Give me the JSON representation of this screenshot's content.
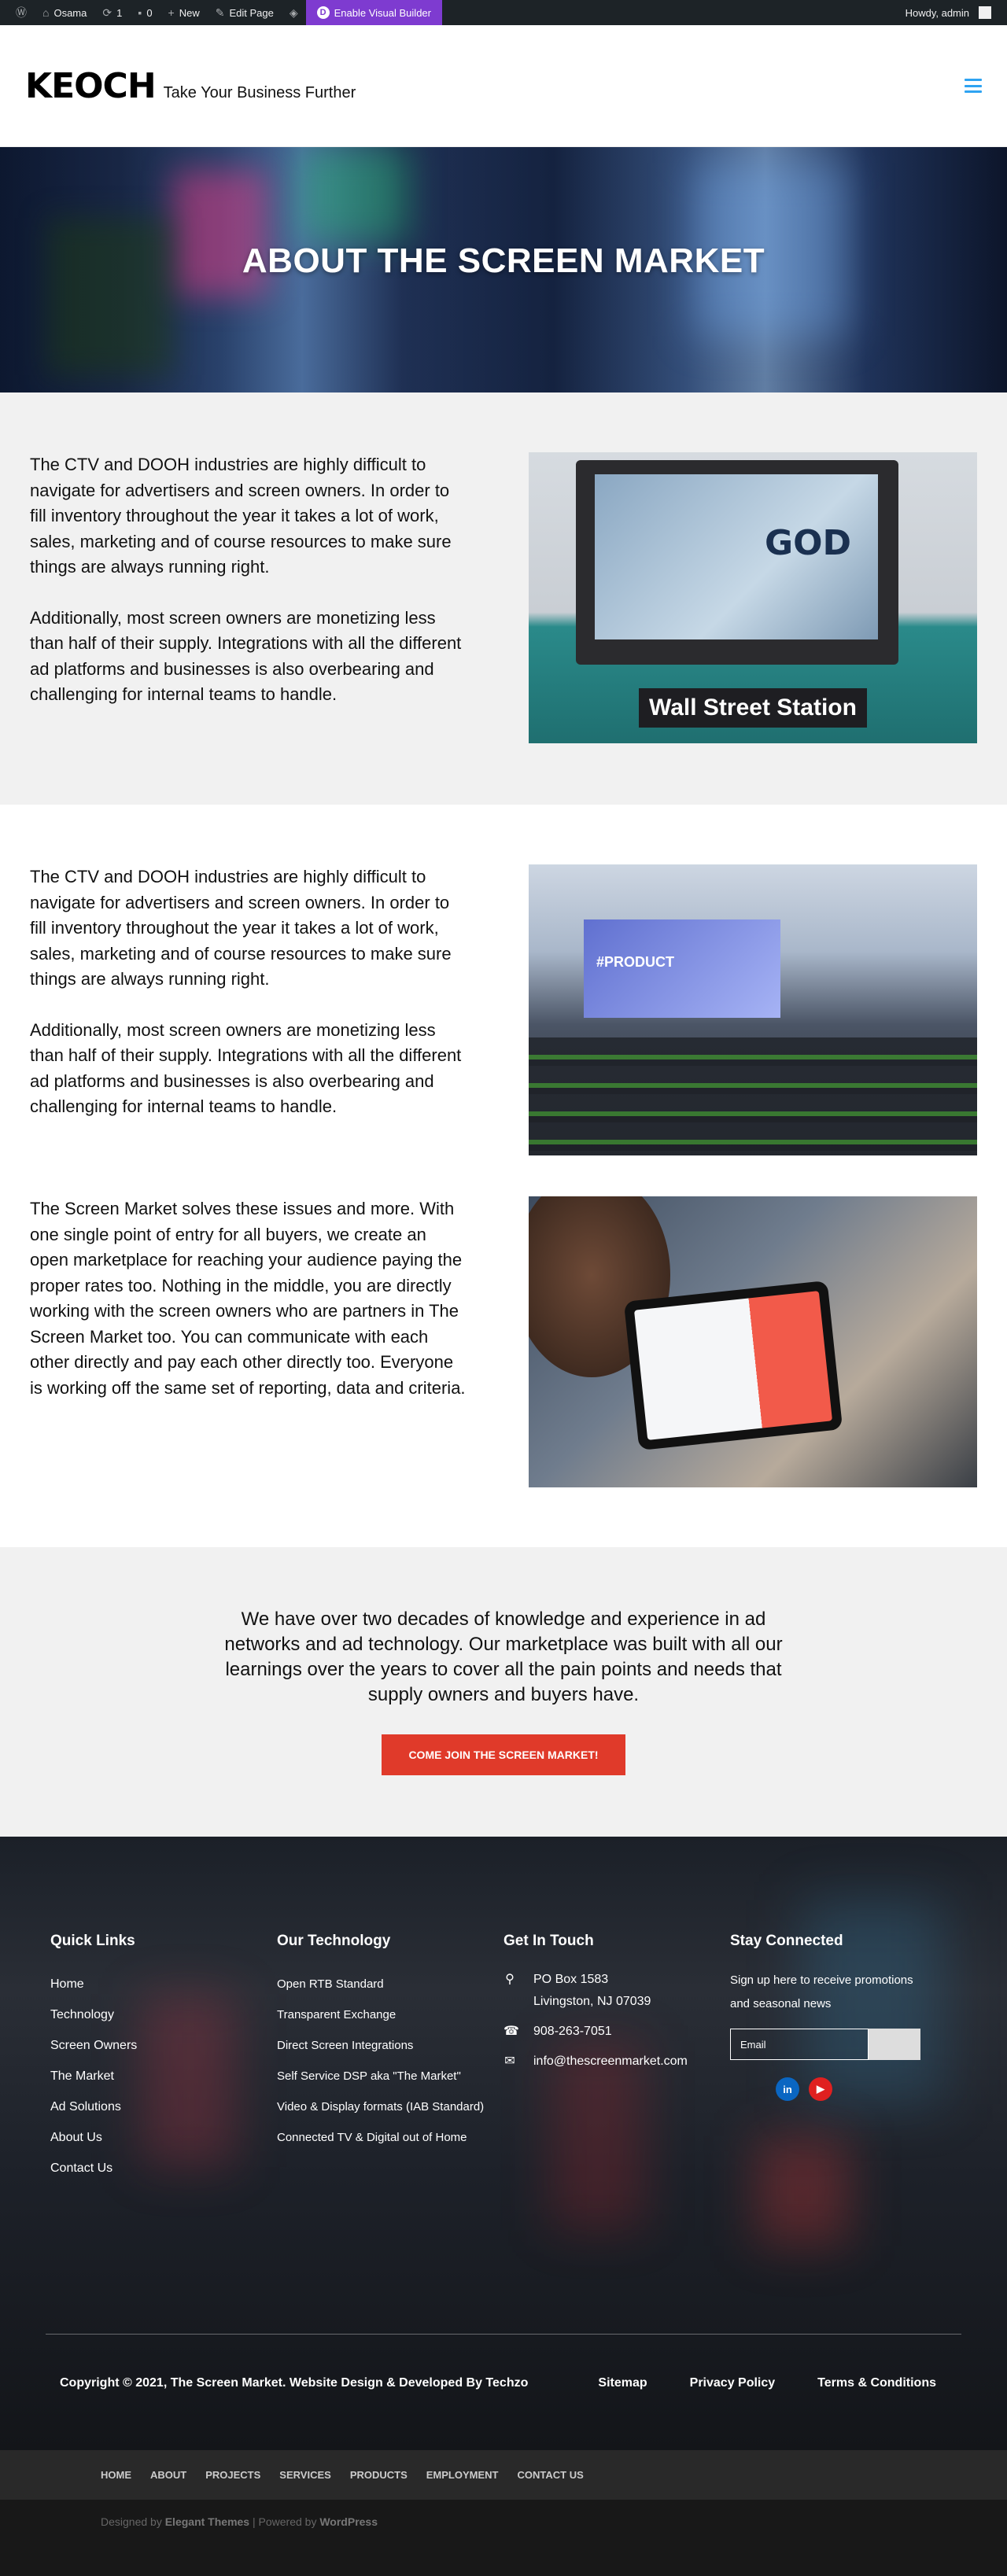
{
  "adminbar": {
    "site_name": "Osama",
    "updates": "1",
    "comments": "0",
    "new_label": "New",
    "edit_label": "Edit Page",
    "builder_label": "Enable Visual Builder",
    "greeting": "Howdy, admin"
  },
  "header": {
    "logo": "KEOCH",
    "tagline": "Take Your Business Further"
  },
  "hero": {
    "title": "ABOUT THE SCREEN MARKET"
  },
  "section1": {
    "p1": "The CTV and DOOH industries are highly difficult to navigate for advertisers and screen owners. In order to fill inventory throughout the year it takes a lot of work, sales, marketing and of course resources to make sure things are always running right.",
    "p2": "Additionally, most screen owners are monetizing less than half of their supply. Integrations with all the different ad platforms and businesses is also overbearing and challenging for internal teams to handle.",
    "image_sign": "Wall Street Station",
    "image_screen": "GOD"
  },
  "section2": {
    "p1": "The CTV and DOOH industries are highly difficult to navigate for advertisers and screen owners. In order to fill inventory throughout the year it takes a lot of work, sales, marketing and of course resources to make sure things are always running right.",
    "p2": "Additionally, most screen owners are monetizing less than half of their supply. Integrations with all the different ad platforms and businesses is also overbearing and challenging for internal teams to handle.",
    "image_screen": "#PRODUCT"
  },
  "section3": {
    "p1": "The Screen Market solves these issues and more. With one single point of entry for all buyers, we create an open marketplace for reaching your audience paying the proper rates too. Nothing in the middle, you are directly working with the screen owners who are partners in The Screen Market too. You can communicate with each other directly and pay each other directly too. Everyone is working off the same set of reporting, data and criteria."
  },
  "cta": {
    "text": "We have over two decades of knowledge and experience in ad networks and ad technology. Our marketplace was built with all our learnings over the years to cover all the pain points and needs that supply owners and buyers have.",
    "button": "COME JOIN THE SCREEN MARKET!"
  },
  "footer": {
    "quick_links": {
      "title": "Quick Links",
      "items": [
        "Home",
        "Technology",
        "Screen Owners",
        "The Market",
        "Ad Solutions",
        "About Us",
        "Contact Us"
      ]
    },
    "technology": {
      "title": "Our Technology",
      "items": [
        "Open RTB Standard",
        "Transparent Exchange",
        "Direct Screen Integrations",
        "Self Service DSP aka \"The Market\"",
        "Video & Display formats (IAB Standard)",
        "Connected TV & Digital out of Home"
      ]
    },
    "contact": {
      "title": "Get In Touch",
      "address_line1": "PO Box 1583",
      "address_line2": "Livingston, NJ 07039",
      "phone": "908-263-7051",
      "email": "info@thescreenmarket.com"
    },
    "stay": {
      "title": "Stay Connected",
      "text": "Sign up here to receive promotions and seasonal news",
      "email_placeholder": "Email"
    },
    "copyright": "Copyright © 2021, The Screen Market. Website Design & Developed By Techzo",
    "bottom_links": [
      "Sitemap",
      "Privacy Policy",
      "Terms & Conditions"
    ]
  },
  "subnav": [
    "HOME",
    "ABOUT",
    "PROJECTS",
    "SERVICES",
    "PRODUCTS",
    "EMPLOYMENT",
    "CONTACT US"
  ],
  "credits": {
    "prefix": "Designed by ",
    "theme": "Elegant Themes",
    "sep": " | Powered by ",
    "wp": "WordPress"
  },
  "colors": {
    "adminbar": "#1d2327",
    "builder": "#7e3bd0",
    "accent_blue": "#2ea3f2",
    "cta_red": "#e03a2a",
    "section_grey": "#f1f1f1"
  },
  "icons": [
    "wordpress-icon",
    "home-icon",
    "refresh-icon",
    "comment-icon",
    "plus-icon",
    "pencil-icon",
    "divi-icon",
    "menu-icon",
    "map-pin-icon",
    "phone-icon",
    "envelope-icon",
    "linkedin-icon",
    "youtube-icon"
  ]
}
